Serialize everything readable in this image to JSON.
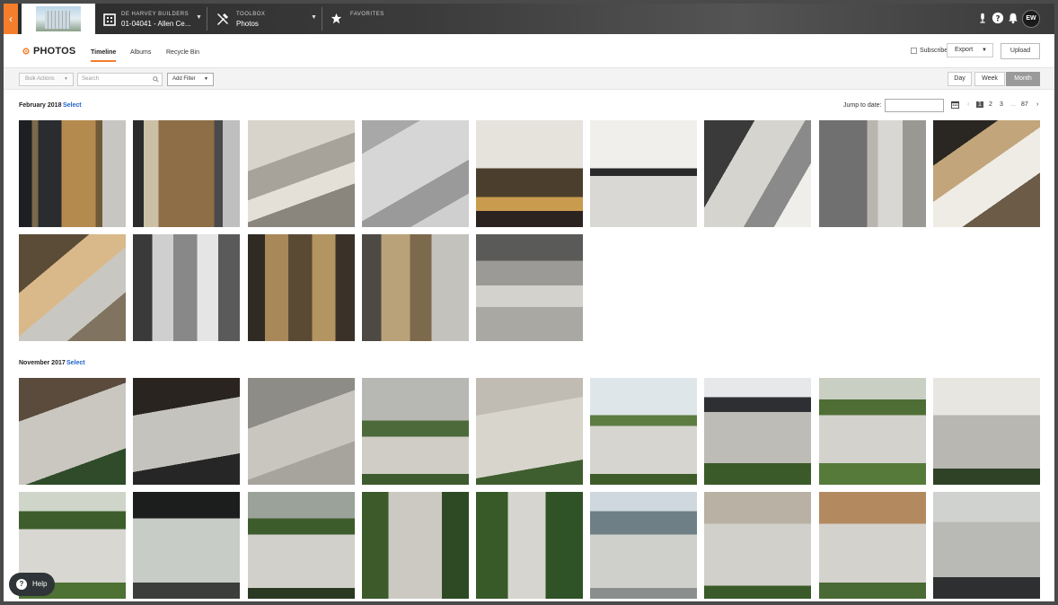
{
  "topbar": {
    "company": "DE HARVEY BUILDERS",
    "project": "01-04041 - Allen Ce...",
    "toolbox_label": "TOOLBOX",
    "tool": "Photos",
    "favorites_label": "FAVORITES",
    "user_initials": "EW"
  },
  "header": {
    "title": "PHOTOS",
    "tabs": [
      "Timeline",
      "Albums",
      "Recycle Bin"
    ],
    "subscribe_label": "Subscribe",
    "export_label": "Export",
    "upload_label": "Upload"
  },
  "filters": {
    "bulk_actions": "Bulk Actions",
    "search_placeholder": "Search",
    "add_filter": "Add Filter",
    "views": [
      "Day",
      "Week",
      "Month"
    ],
    "active_view": "Month"
  },
  "timeline": {
    "jump_label": "Jump to date:",
    "pages": [
      "1",
      "2",
      "3",
      "...",
      "87"
    ],
    "sections": [
      {
        "label": "February 2018",
        "select": "Select",
        "photo_count": 14
      },
      {
        "label": "November 2017",
        "select": "Select",
        "photo_count": 18
      }
    ]
  },
  "help": {
    "label": "Help"
  },
  "colors": {
    "accent": "#f47e2c",
    "link": "#1e62c8"
  }
}
